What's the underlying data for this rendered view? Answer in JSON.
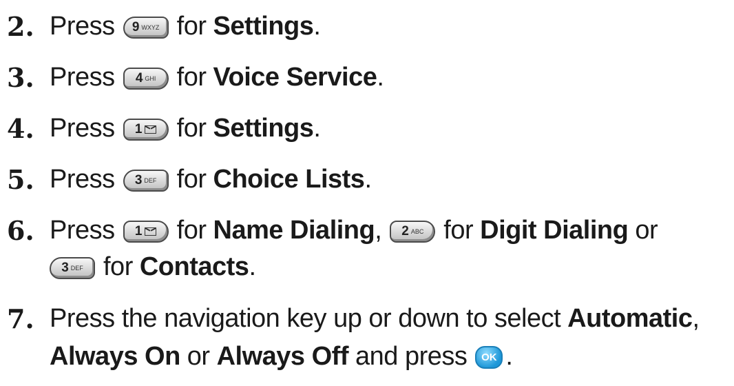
{
  "steps": [
    {
      "num": "2.",
      "press": "Press",
      "key": {
        "digit": "9",
        "letters": "WXYZ"
      },
      "for": "for",
      "target": "Settings",
      "end": "."
    },
    {
      "num": "3.",
      "press": "Press",
      "key": {
        "digit": "4",
        "letters": "GHI"
      },
      "for": "for",
      "target": "Voice Service",
      "end": "."
    },
    {
      "num": "4.",
      "press": "Press",
      "key": {
        "digit": "1",
        "letters": "envelope-icon"
      },
      "for": "for",
      "target": "Settings",
      "end": "."
    },
    {
      "num": "5.",
      "press": "Press",
      "key": {
        "digit": "3",
        "letters": "DEF"
      },
      "for": "for",
      "target": "Choice Lists",
      "end": "."
    },
    {
      "num": "6.",
      "press": "Press",
      "key1": {
        "digit": "1",
        "letters": "envelope-icon"
      },
      "for1": "for",
      "target1": "Name Dialing",
      "comma": ",",
      "key2": {
        "digit": "2",
        "letters": "ABC"
      },
      "for2": "for",
      "target2": "Digit Dialing",
      "or": "or",
      "key3": {
        "digit": "3",
        "letters": "DEF"
      },
      "for3": "for",
      "target3": "Contacts",
      "end": "."
    },
    {
      "num": "7.",
      "line1": "Press the navigation key up or down to select",
      "opt1": "Automatic",
      "comma": ",",
      "opt2": "Always On",
      "or": "or",
      "opt3": "Always Off",
      "and_press": "and press",
      "ok_label": "OK",
      "end": "."
    }
  ]
}
